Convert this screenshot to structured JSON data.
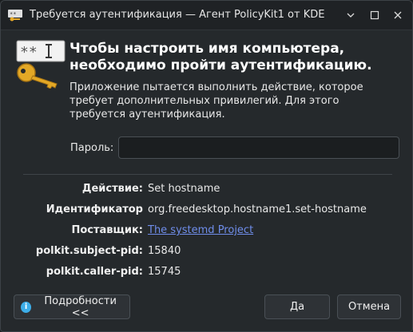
{
  "window": {
    "title": "Требуется аутентификация — Агент PolicyKit1 от KDE"
  },
  "header": {
    "heading": "Чтобы настроить имя компьютера, необходимо пройти аутентификацию.",
    "description": "Приложение пытается выполнить действие, которое требует дополнительных привилегий. Для этого требуется аутентификация.",
    "icon": "password-key-icon"
  },
  "password": {
    "label": "Пароль:",
    "value": ""
  },
  "details": [
    {
      "key": "Действие:",
      "value": "Set hostname",
      "link": false
    },
    {
      "key": "Идентификатор",
      "value": "org.freedesktop.hostname1.set-hostname",
      "link": false
    },
    {
      "key": "Поставщик:",
      "value": "The systemd Project",
      "link": true
    },
    {
      "key": "polkit.subject-pid:",
      "value": "15840",
      "link": false
    },
    {
      "key": "polkit.caller-pid:",
      "value": "15745",
      "link": false
    }
  ],
  "buttons": {
    "details": "Подробности <<",
    "ok": "Да",
    "cancel": "Отмена"
  },
  "colors": {
    "accent": "#3daee9",
    "link": "#6f8dea",
    "background": "#25292c"
  }
}
